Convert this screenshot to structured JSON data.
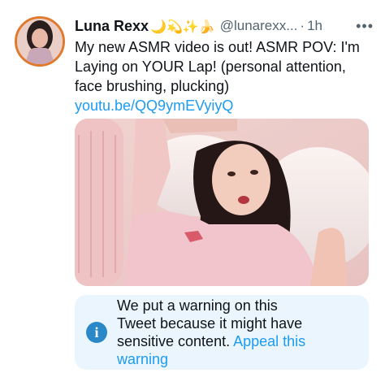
{
  "tweet": {
    "author_name": "Luna Rexx",
    "name_emojis": "🌙💫✨🍌",
    "handle": "@lunarexx...",
    "separator": "·",
    "time": "1h",
    "more_icon": "•••",
    "text": "My new ASMR video is out! ASMR POV: I'm Laying on YOUR Lap! (personal attention, face brushing, plucking)",
    "link": "youtu.be/QQ9ymEVyiyQ"
  },
  "warning": {
    "message": "We put a warning on this Tweet because it might have sensitive content.",
    "appeal_label": "Appeal this warning",
    "icon_glyph": "i"
  },
  "colors": {
    "link": "#1d9bf0",
    "avatar_ring": "#e07a2e",
    "warning_bg": "#eaf5fd",
    "info_icon": "#2a88c9"
  }
}
